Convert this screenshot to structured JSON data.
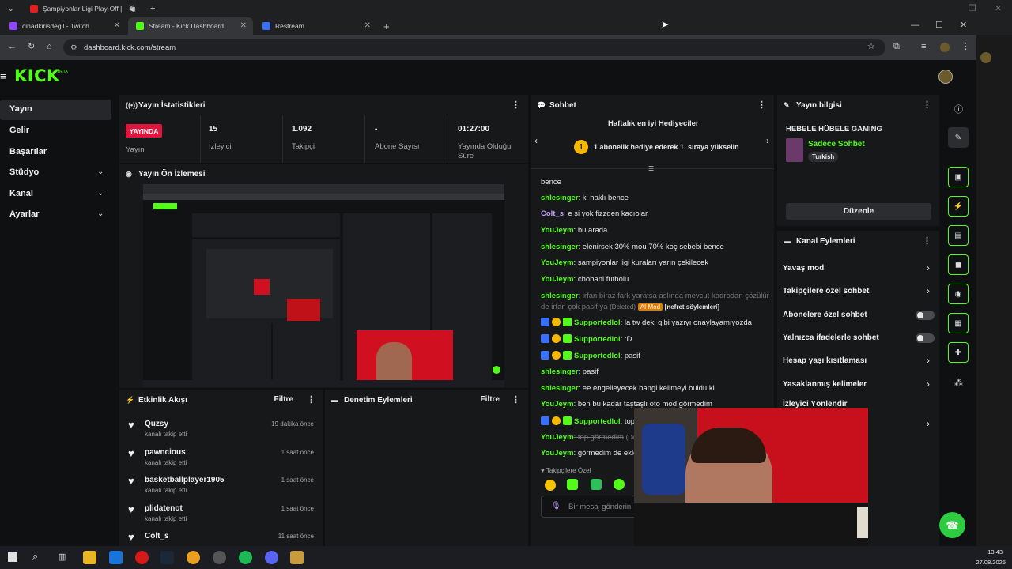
{
  "browser": {
    "tabs": [
      {
        "title": "Şampiyonlar Ligi Play-Off |",
        "active": false
      },
      {
        "title": "cihadkirisdegil - Twitch",
        "active": false
      },
      {
        "title": "Stream - Kick Dashboard",
        "active": true
      },
      {
        "title": "Restream",
        "active": false
      }
    ],
    "url": "dashboard.kick.com/stream"
  },
  "sidebar": {
    "items": [
      {
        "label": "Yayın",
        "active": true,
        "chevron": false
      },
      {
        "label": "Gelir",
        "chevron": false
      },
      {
        "label": "Başarılar",
        "chevron": false
      },
      {
        "label": "Stüdyo",
        "chevron": true
      },
      {
        "label": "Kanal",
        "chevron": true
      },
      {
        "label": "Ayarlar",
        "chevron": true
      }
    ]
  },
  "logo": {
    "text": "KICK",
    "beta": "BETA"
  },
  "stats": {
    "title": "Yayın İstatistikleri",
    "badge": "YAYINDA",
    "badge_label": "Yayın",
    "items": [
      {
        "value": "15",
        "label": "İzleyici"
      },
      {
        "value": "1.092",
        "label": "Takipçi"
      },
      {
        "value": "-",
        "label": "Abone Sayısı"
      },
      {
        "value": "01:27:00",
        "label": "Yayında Olduğu Süre"
      }
    ]
  },
  "preview": {
    "title": "Yayın Ön İzlemesi"
  },
  "activity": {
    "title": "Etkinlik Akışı",
    "filter": "Filtre",
    "items": [
      {
        "name": "Quzsy",
        "sub": "kanalı takip etti",
        "time": "19 dakika önce"
      },
      {
        "name": "pawncious",
        "sub": "kanalı takip etti",
        "time": "1 saat önce"
      },
      {
        "name": "basketballplayer1905",
        "sub": "kanalı takip etti",
        "time": "1 saat önce"
      },
      {
        "name": "plidatenot",
        "sub": "kanalı takip etti",
        "time": "1 saat önce"
      },
      {
        "name": "Colt_s",
        "sub": "",
        "time": "11 saat önce"
      }
    ]
  },
  "moderation": {
    "title": "Denetim Eylemleri",
    "filter": "Filtre"
  },
  "chat": {
    "title": "Sohbet",
    "gifters_title": "Haftalık en iyi Hediyeciler",
    "gifters_text": "1 abonelik hediye ederek 1. sıraya yükselin",
    "gifters_rank": "1",
    "lines": [
      {
        "user": "",
        "text": "bence",
        "color": "none"
      },
      {
        "user": "shlesinger",
        "text": ": ki haklı bence",
        "color": "g"
      },
      {
        "user": "Colt_s",
        "text": ": e si yok fizzden kacıolar",
        "color": "p"
      },
      {
        "user": "YouJeym",
        "text": ": bu arada",
        "color": "g"
      },
      {
        "user": "shlesinger",
        "text": ": elenirsek 30% mou 70% koç sebebi bence",
        "color": "g"
      },
      {
        "user": "YouJeym",
        "text": ": şampiyonlar ligi kuraları yarın çekilecek",
        "color": "g"
      },
      {
        "user": "YouJeym",
        "text": ": chobani futbolu",
        "color": "g"
      },
      {
        "user": "shlesinger",
        "text": ": irfan biraz fark yaratsa aslında mevcut kadrodan çözülür",
        "color": "g",
        "deleted": true
      },
      {
        "user": "",
        "text": "de irfan çok pasif ya",
        "color": "none",
        "deleted": true,
        "tag": "(Deleted)",
        "mod": "AI Mod",
        "reason": "[nefret söylemleri]"
      },
      {
        "user": "Supportedlol",
        "text": ": la tw deki gibi yazıyı onaylayamıyozda",
        "color": "g",
        "badges": true
      },
      {
        "user": "Supportedlol",
        "text": ": :D",
        "color": "g",
        "badges": true
      },
      {
        "user": "Supportedlol",
        "text": ": pasif",
        "color": "g",
        "badges": true
      },
      {
        "user": "shlesinger",
        "text": ": pasif",
        "color": "g"
      },
      {
        "user": "shlesinger",
        "text": ": ee engelleyecek hangi kelimeyi buldu ki",
        "color": "g"
      },
      {
        "user": "YouJeym",
        "text": ": ben bu kadar taştaşlı oto mod görmedim",
        "color": "g"
      },
      {
        "user": "Supportedlol",
        "text": ": top",
        "color": "g",
        "badges": true
      },
      {
        "user": "YouJeym",
        "text": ": top görmedim",
        "color": "g",
        "deleted": true,
        "tag": "(De"
      },
      {
        "user": "YouJeym",
        "text": ": görmedim de ekle",
        "color": "g"
      }
    ],
    "followers_only": "Takipçilere Özel",
    "input_placeholder": "Bir mesaj gönderin"
  },
  "stream_info": {
    "title": "Yayın bilgisi",
    "stream_title": "HEBELE HÜBELE GAMING",
    "category": "Sadece Sohbet",
    "language": "Turkish",
    "edit": "Düzenle"
  },
  "channel_actions": {
    "title": "Kanal Eylemleri",
    "rows": [
      {
        "label": "Yavaş mod",
        "control": "chevron"
      },
      {
        "label": "Takipçilere özel sohbet",
        "control": "chevron"
      },
      {
        "label": "Abonelere özel sohbet",
        "control": "toggle",
        "on": false
      },
      {
        "label": "Yalnızca ifadelerle sohbet",
        "control": "toggle",
        "on": false
      },
      {
        "label": "Hesap yaşı kısıtlaması",
        "control": "chevron"
      },
      {
        "label": "Yasaklanmış kelimeler",
        "control": "chevron"
      },
      {
        "label": "İzleyici Yönlendir",
        "control": "chevron"
      }
    ]
  },
  "taskbar": {
    "time": "13:43",
    "date": "27.08.2025"
  },
  "colors": {
    "accent": "#53fc18",
    "live": "#e0153d",
    "panel": "#17181a"
  }
}
